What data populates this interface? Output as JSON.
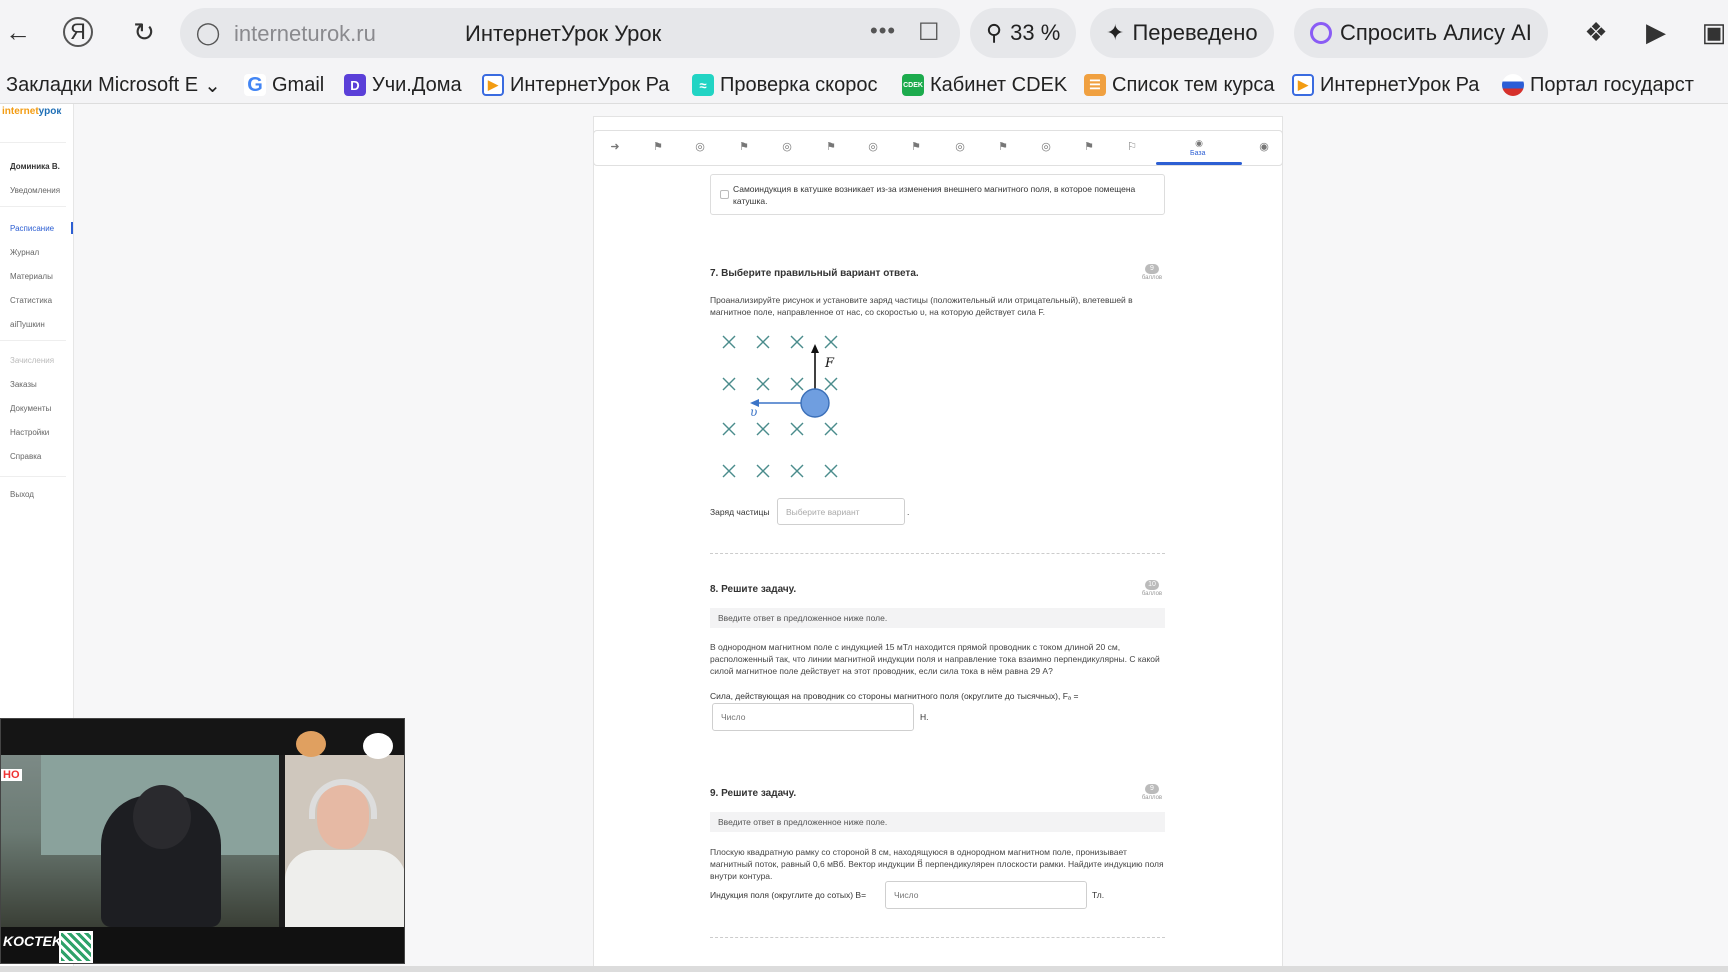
{
  "browser": {
    "domain": "interneturok.ru",
    "page_title": "ИнтернетУрок Урок",
    "zoom": "33 %",
    "translate_label": "Переведено",
    "alice_label": "Спросить Алису AI"
  },
  "bookmarks": [
    {
      "label": "Закладки Microsoft E",
      "icon": "folder-icon"
    },
    {
      "label": "Gmail",
      "icon": "google-icon"
    },
    {
      "label": "Учи.Дома",
      "icon": "uchi-icon"
    },
    {
      "label": "ИнтернетУрок Ра",
      "icon": "play-icon"
    },
    {
      "label": "Проверка скорос",
      "icon": "speedtest-icon"
    },
    {
      "label": "Кабинет CDEK",
      "icon": "cdek-icon"
    },
    {
      "label": "Список тем курса",
      "icon": "list-icon"
    },
    {
      "label": "ИнтернетУрок Ра",
      "icon": "play-icon"
    },
    {
      "label": "Портал государст",
      "icon": "gov-icon"
    }
  ],
  "sidebar": {
    "logo_part1": "internet",
    "logo_part2": "урок",
    "user": "Доминика В.",
    "items": [
      {
        "label": "Уведомления"
      },
      {
        "label": "Расписание"
      },
      {
        "label": "Журнал"
      },
      {
        "label": "Материалы"
      },
      {
        "label": "Статистика"
      },
      {
        "label": "aiПушкин"
      },
      {
        "label": "Зачисления"
      },
      {
        "label": "Заказы"
      },
      {
        "label": "Документы"
      },
      {
        "label": "Настройки"
      },
      {
        "label": "Справка"
      },
      {
        "label": "Выход"
      }
    ]
  },
  "stepbar": {
    "active_label": "База"
  },
  "prev_option": {
    "text": "Самоиндукция в катушке возникает из-за изменения внешнего магнитного поля, в которое помещена катушка."
  },
  "q7": {
    "title": "7. Выберите правильный вариант ответа.",
    "points": "9",
    "points_label": "баллов",
    "text": "Проанализируйте рисунок и установите заряд частицы (положительный или отрицательный), влетевшей в магнитное поле, направленное от нас, со скоростью υ, на которую действует сила F.",
    "figure_force_label": "F",
    "figure_velocity_label": "υ",
    "answer_label": "Заряд частицы",
    "select_placeholder": "Выберите вариант",
    "after": "."
  },
  "q8": {
    "title": "8. Решите задачу.",
    "points": "10",
    "points_label": "баллов",
    "hint": "Введите ответ в предложенное ниже поле.",
    "text": "В однородном магнитном поле с индукцией 15 мТл находится прямой проводник с током длиной 20 см, расположенный так, что линии магнитной индукции поля и направление тока взаимно перпендикулярны. С какой силой магнитное поле действует на этот проводник, если сила тока в нём равна 29 А?",
    "answer_label": "Сила, действующая на проводник со стороны магнитного поля (округлите до тысячных), Fₐ =",
    "placeholder": "Число",
    "unit": "Н."
  },
  "q9": {
    "title": "9. Решите задачу.",
    "points": "9",
    "points_label": "баллов",
    "hint": "Введите ответ в предложенное ниже поле.",
    "text": "Плоскую квадратную рамку со стороной 8 см, находящуюся в однородном магнитном поле, пронизывает магнитный поток, равный 0,6 мВб. Вектор индукции B⃗ перпендикулярен плоскости рамки. Найдите индукцию поля внутри контура.",
    "answer_label": "Индукция поля (округлите до сотых) B=",
    "placeholder": "Число",
    "unit": "Тл."
  },
  "stream": {
    "tag_top": "",
    "tag_bottom": "KOCTEK",
    "tag_left": "НО"
  }
}
